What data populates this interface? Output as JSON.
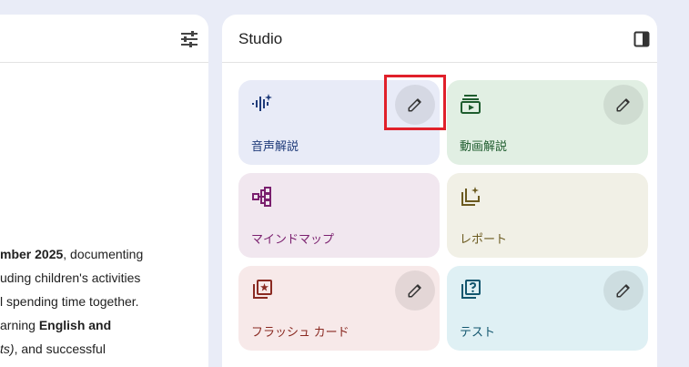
{
  "left_panel": {
    "lines": [
      {
        "bold_prefix": "mber 2025",
        "text": ", documenting"
      },
      {
        "text": "uding children's activities"
      },
      {
        "text": "l spending time together."
      },
      {
        "text_prefix": "arning ",
        "bold": "English and"
      },
      {
        "italic_prefix": "ts)",
        "text": ", and successful"
      }
    ]
  },
  "studio": {
    "title": "Studio",
    "tiles": [
      {
        "label": "音声解説",
        "icon": "audio-waveform-icon",
        "bg": "#e8ebf7",
        "fg": "#1f3b7a",
        "edit": true
      },
      {
        "label": "動画解説",
        "icon": "video-overview-icon",
        "bg": "#e1efe3",
        "fg": "#1e5c2e",
        "edit": true
      },
      {
        "label": "マインドマップ",
        "icon": "mind-map-icon",
        "bg": "#f1e7ef",
        "fg": "#7a1f6e",
        "edit": false
      },
      {
        "label": "レポート",
        "icon": "report-icon",
        "bg": "#f1f0e6",
        "fg": "#6b5a1f",
        "edit": false
      },
      {
        "label": "フラッシュ カード",
        "icon": "flashcards-icon",
        "bg": "#f7e9e9",
        "fg": "#8a2a22",
        "edit": true
      },
      {
        "label": "テスト",
        "icon": "quiz-icon",
        "bg": "#dff0f4",
        "fg": "#12566e",
        "edit": true
      }
    ]
  },
  "colors": {
    "page_bg": "#e9ecf7",
    "highlight": "#e0202a"
  }
}
